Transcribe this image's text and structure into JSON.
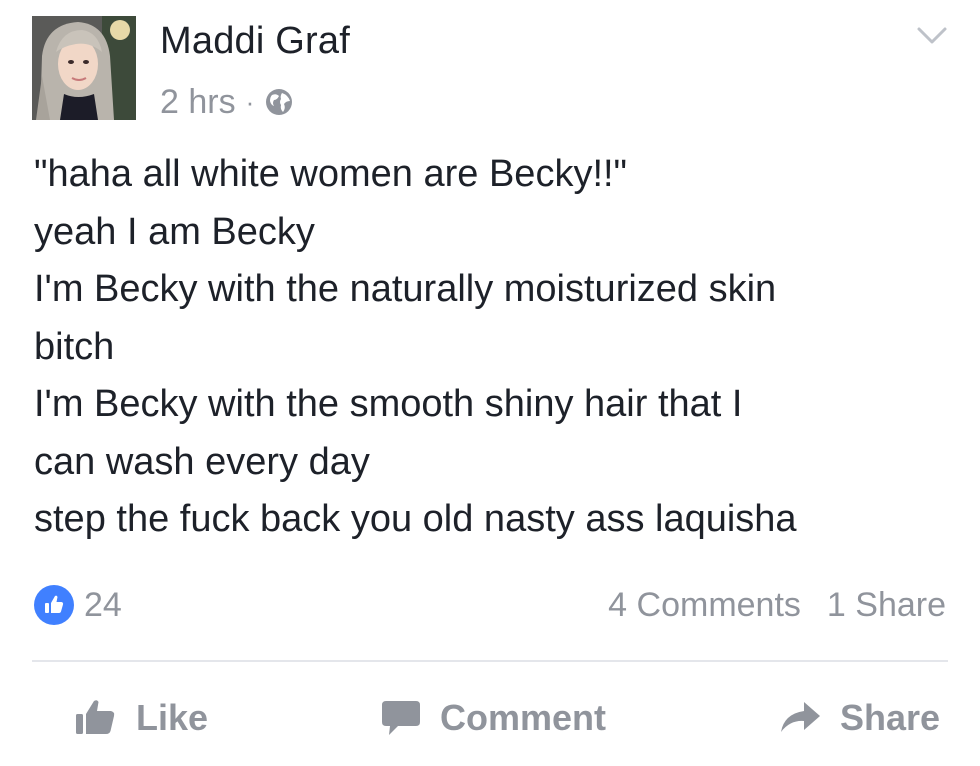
{
  "post": {
    "author": "Maddi Graf",
    "time": "2 hrs",
    "separator": "·",
    "privacy_icon": "globe-icon",
    "menu_icon": "chevron-down-icon",
    "text_lines": [
      "\"haha all white women are Becky!!\"",
      "yeah I am Becky",
      "I'm Becky with the naturally moisturized skin",
      "bitch",
      "I'm Becky with the smooth shiny hair that I",
      "can wash every day",
      "step the fuck back you old nasty ass laquisha"
    ]
  },
  "stats": {
    "likes": "24",
    "comments": "4 Comments",
    "shares": "1 Share"
  },
  "actions": {
    "like_label": "Like",
    "comment_label": "Comment",
    "share_label": "Share"
  },
  "colors": {
    "text": "#1d2129",
    "muted": "#90949c",
    "like_badge": "#4080ff",
    "divider": "#e4e6eb"
  }
}
